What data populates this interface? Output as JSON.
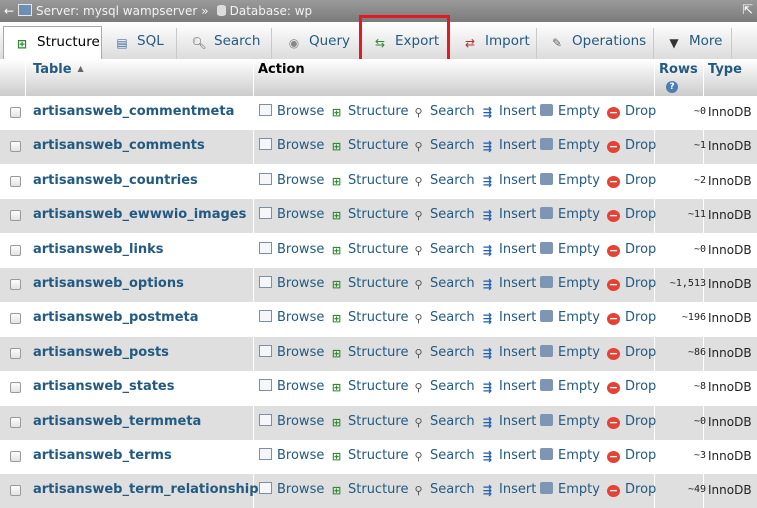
{
  "breadcrumb": {
    "back": "←",
    "server": "Server: mysql wampserver",
    "separator": "»",
    "database": "Database: wp",
    "collapse": "⇱"
  },
  "tabs": [
    {
      "label": "Structure",
      "icon": "structure-icon",
      "active": true
    },
    {
      "label": "SQL",
      "icon": "sql-icon"
    },
    {
      "label": "Search",
      "icon": "search-icon"
    },
    {
      "label": "Query",
      "icon": "query-icon"
    },
    {
      "label": "Export",
      "icon": "export-icon",
      "highlighted": true
    },
    {
      "label": "Import",
      "icon": "import-icon"
    },
    {
      "label": "Operations",
      "icon": "wrench-icon"
    },
    {
      "label": "More",
      "icon": "dropdown-arrow-icon"
    }
  ],
  "table": {
    "headers": {
      "table": "Table",
      "action": "Action",
      "rows": "Rows",
      "type": "Type"
    },
    "actions": [
      "Browse",
      "Structure",
      "Search",
      "Insert",
      "Empty",
      "Drop"
    ],
    "rows": [
      {
        "name": "artisansweb_commentmeta",
        "rows": "~0",
        "type": "InnoDB"
      },
      {
        "name": "artisansweb_comments",
        "rows": "~1",
        "type": "InnoDB"
      },
      {
        "name": "artisansweb_countries",
        "rows": "~2",
        "type": "InnoDB"
      },
      {
        "name": "artisansweb_ewwwio_images",
        "rows": "~11",
        "type": "InnoDB"
      },
      {
        "name": "artisansweb_links",
        "rows": "~0",
        "type": "InnoDB"
      },
      {
        "name": "artisansweb_options",
        "rows": "~1,513",
        "type": "InnoDB"
      },
      {
        "name": "artisansweb_postmeta",
        "rows": "~196",
        "type": "InnoDB"
      },
      {
        "name": "artisansweb_posts",
        "rows": "~86",
        "type": "InnoDB"
      },
      {
        "name": "artisansweb_states",
        "rows": "~8",
        "type": "InnoDB"
      },
      {
        "name": "artisansweb_termmeta",
        "rows": "~0",
        "type": "InnoDB"
      },
      {
        "name": "artisansweb_terms",
        "rows": "~3",
        "type": "InnoDB"
      },
      {
        "name": "artisansweb_term_relationships",
        "rows": "~49",
        "type": "InnoDB"
      }
    ]
  },
  "colors": {
    "link": "#235a81",
    "highlight": "#e11b22",
    "row_alt": "#dfdfdf"
  }
}
